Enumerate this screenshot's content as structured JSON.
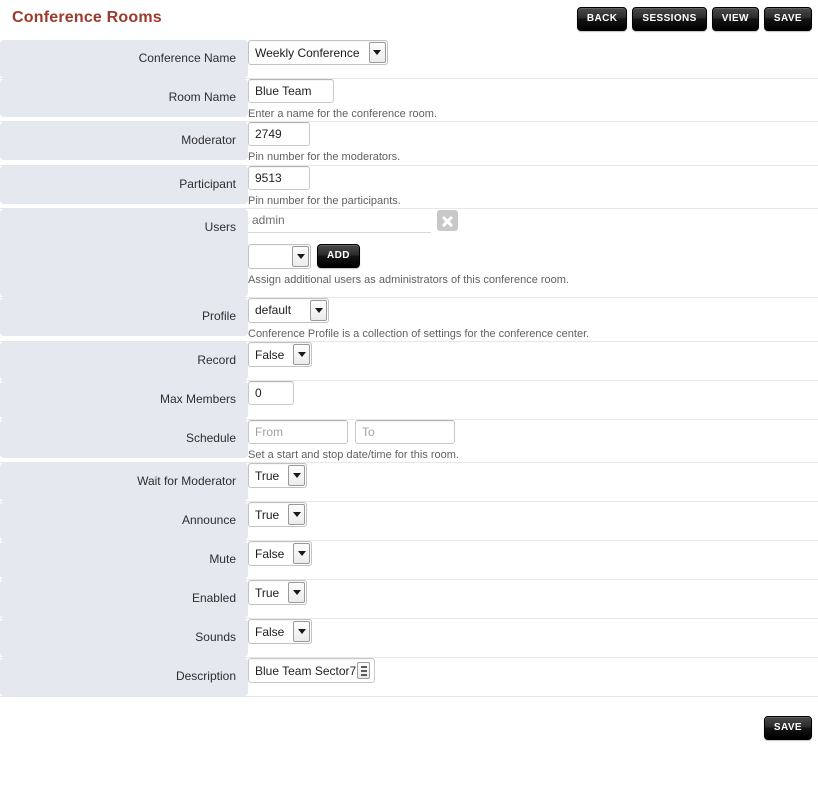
{
  "header": {
    "title": "Conference Rooms",
    "title_color": "#9c3a2c",
    "buttons": [
      {
        "label": "BACK",
        "name": "back-button"
      },
      {
        "label": "SESSIONS",
        "name": "sessions-button"
      },
      {
        "label": "VIEW",
        "name": "view-button"
      },
      {
        "label": "SAVE",
        "name": "save-button-top"
      }
    ]
  },
  "form": {
    "conference_name": {
      "label": "Conference Name",
      "value": "Weekly Conference"
    },
    "room_name": {
      "label": "Room Name",
      "value": "Blue Team",
      "hint": "Enter a name for the conference room."
    },
    "moderator": {
      "label": "Moderator",
      "value": "2749",
      "hint": "Pin number for the moderators."
    },
    "participant": {
      "label": "Participant",
      "value": "9513",
      "hint": "Pin number for the participants."
    },
    "users": {
      "label": "Users",
      "value": "admin",
      "remove_icon": "close-x-icon",
      "select_value": "",
      "add_label": "ADD",
      "hint": "Assign additional users as administrators of this conference room."
    },
    "profile": {
      "label": "Profile",
      "value": "default",
      "hint": "Conference Profile is a collection of settings for the conference center."
    },
    "record": {
      "label": "Record",
      "value": "False"
    },
    "max_members": {
      "label": "Max Members",
      "value": "0"
    },
    "schedule": {
      "label": "Schedule",
      "from_value": "",
      "from_placeholder": "From",
      "to_value": "",
      "to_placeholder": "To",
      "hint": "Set a start and stop date/time for this room."
    },
    "wait_for_moderator": {
      "label": "Wait for Moderator",
      "value": "True"
    },
    "announce": {
      "label": "Announce",
      "value": "True"
    },
    "mute": {
      "label": "Mute",
      "value": "False"
    },
    "enabled": {
      "label": "Enabled",
      "value": "True"
    },
    "sounds": {
      "label": "Sounds",
      "value": "False"
    },
    "description": {
      "label": "Description",
      "value": "Blue Team Sector7",
      "resize_icon": "resize-grip-icon"
    }
  },
  "footer": {
    "save_label": "SAVE"
  }
}
